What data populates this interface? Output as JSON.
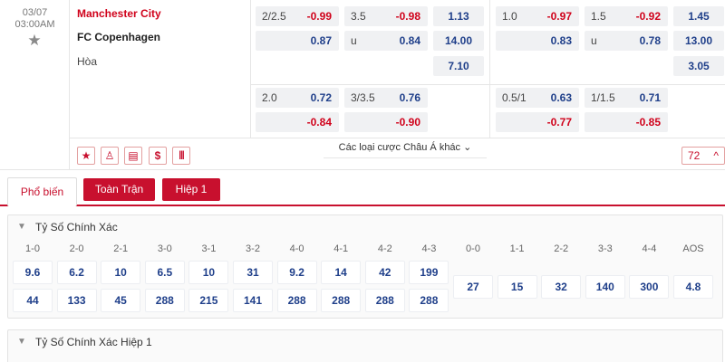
{
  "match": {
    "date": "03/07",
    "time": "03:00AM",
    "home_team": "Manchester City",
    "away_team": "FC Copenhagen",
    "draw_label": "Hòa"
  },
  "odds": {
    "ft_handicap": {
      "line1": "2/2.5",
      "home1": "-0.99",
      "away1": "0.87",
      "line2": "2.0",
      "home2": "0.72",
      "away2": "-0.84"
    },
    "ft_overunder": {
      "line1": "3.5",
      "over1": "-0.98",
      "under_label": "u",
      "under1": "0.84",
      "line2": "3/3.5",
      "over2": "0.76",
      "under2": "-0.90"
    },
    "ft_1x2": {
      "home": "1.13",
      "away": "14.00",
      "draw": "7.10"
    },
    "h1_handicap": {
      "line1": "1.0",
      "home1": "-0.97",
      "away1": "0.83",
      "line2": "0.5/1",
      "home2": "0.63",
      "away2": "-0.77"
    },
    "h1_overunder": {
      "line1": "1.5",
      "over1": "-0.92",
      "under_label": "u",
      "under1": "0.78",
      "line2": "1/1.5",
      "over2": "0.71",
      "under2": "-0.85"
    },
    "h1_1x2": {
      "home": "1.45",
      "away": "13.00",
      "draw": "3.05"
    }
  },
  "toolbar": {
    "icons": [
      "star-icon",
      "shirt-icon",
      "ticket-icon",
      "dollar-icon",
      "stats-icon"
    ],
    "star_glyph": "★",
    "shirt_glyph": "♙",
    "ticket_glyph": "▤",
    "dollar_glyph": "$",
    "stats_glyph": "|||",
    "more_label": "Các loại cược Châu Á khác",
    "more_chevron": "⌄",
    "count": "72",
    "count_chevron": "^"
  },
  "tabs": {
    "popular": "Phổ biến",
    "fulltime": "Toàn Trận",
    "half1": "Hiệp 1"
  },
  "correct_score": {
    "title": "Tỷ Số Chính Xác",
    "caret": "▼",
    "home_scores": [
      "1-0",
      "2-0",
      "2-1",
      "3-0",
      "3-1",
      "3-2",
      "4-0",
      "4-1",
      "4-2",
      "4-3"
    ],
    "home_odds": [
      "9.6",
      "6.2",
      "10",
      "6.5",
      "10",
      "31",
      "9.2",
      "14",
      "42",
      "199"
    ],
    "away_odds": [
      "44",
      "133",
      "45",
      "288",
      "215",
      "141",
      "288",
      "288",
      "288",
      "288"
    ],
    "draw_scores": [
      "0-0",
      "1-1",
      "2-2",
      "3-3",
      "4-4",
      "AOS"
    ],
    "draw_odds": [
      "27",
      "15",
      "32",
      "140",
      "300",
      "4.8"
    ]
  },
  "correct_score_h1": {
    "title": "Tỷ Số Chính Xác Hiệp 1",
    "caret": "▼"
  }
}
